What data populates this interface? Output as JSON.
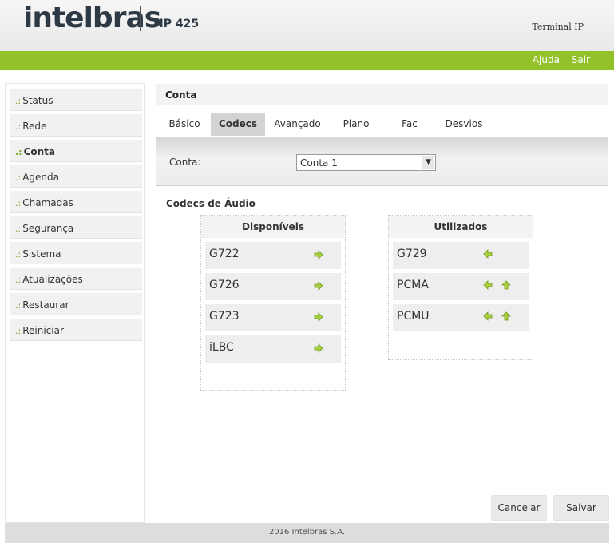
{
  "header": {
    "brand": "intelbras",
    "model": "TIP 425",
    "device_label": "Terminal IP"
  },
  "topnav": {
    "help": "Ajuda",
    "logout": "Sair"
  },
  "sidebar": {
    "items": [
      {
        "label": "Status"
      },
      {
        "label": "Rede"
      },
      {
        "label": "Conta"
      },
      {
        "label": "Agenda"
      },
      {
        "label": "Chamadas"
      },
      {
        "label": "Segurança"
      },
      {
        "label": "Sistema"
      },
      {
        "label": "Atualizações"
      },
      {
        "label": "Restaurar"
      },
      {
        "label": "Reiniciar"
      }
    ],
    "active": "Conta",
    "bullet": ".:"
  },
  "main": {
    "title": "Conta",
    "tabs": [
      {
        "label": "Básico"
      },
      {
        "label": "Codecs"
      },
      {
        "label": "Avançado"
      },
      {
        "label": "Plano"
      },
      {
        "label": "Fac"
      },
      {
        "label": "Desvios"
      }
    ],
    "active_tab": "Codecs",
    "conta_label": "Conta:",
    "conta_value": "Conta 1",
    "audio_codecs_title": "Codecs de Áudio",
    "available": {
      "title": "Disponíveis",
      "items": [
        {
          "name": "G722"
        },
        {
          "name": "G726"
        },
        {
          "name": "G723"
        },
        {
          "name": "iLBC"
        }
      ]
    },
    "used": {
      "title": "Utilizados",
      "items": [
        {
          "name": "G729"
        },
        {
          "name": "PCMA"
        },
        {
          "name": "PCMU"
        }
      ]
    },
    "cancel_label": "Cancelar",
    "save_label": "Salvar"
  },
  "footer": {
    "text": "2016 Intelbras S.A."
  },
  "colors": {
    "accent_green": "#92c12a",
    "brand_dark": "#2d3945"
  },
  "icons": {
    "add": "arrow-right-icon",
    "remove": "arrow-left-icon",
    "move_up": "arrow-up-icon"
  }
}
